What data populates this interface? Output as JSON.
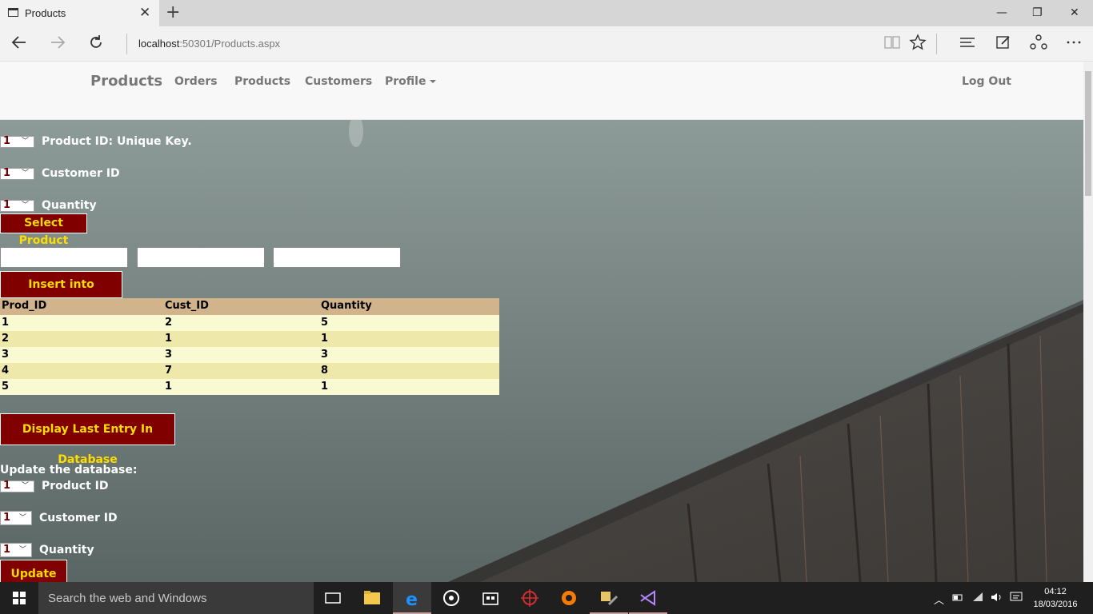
{
  "browser": {
    "tab_title": "Products",
    "tab_close": "✕",
    "new_tab": "+",
    "url_host": "localhost",
    "url_rest": ":50301/Products.aspx",
    "win_min": "—",
    "win_max": "❐",
    "win_close": "✕",
    "icons": [
      "back-icon",
      "forward-icon",
      "refresh-icon",
      "reading-view-icon",
      "favorites-star-icon",
      "hub-icon",
      "web-note-icon",
      "share-icon",
      "more-icon"
    ]
  },
  "navbar": {
    "brand": "Products",
    "links": [
      "Orders",
      "Products",
      "Customers",
      "Profile"
    ],
    "logout": "Log Out"
  },
  "select_form": {
    "product_id_value": "1",
    "product_id_label": "Product ID: Unique Key.",
    "customer_id_value": "1",
    "customer_id_label": "Customer ID",
    "quantity_value": "1",
    "quantity_label": "Quantity",
    "select_button": "Select Product"
  },
  "insert_form": {
    "insert_button": "Insert into Database"
  },
  "products_table": {
    "headers": [
      "Prod_ID",
      "Cust_ID",
      "Quantity"
    ],
    "rows": [
      [
        "1",
        "2",
        "5"
      ],
      [
        "2",
        "1",
        "1"
      ],
      [
        "3",
        "3",
        "3"
      ],
      [
        "4",
        "7",
        "8"
      ],
      [
        "5",
        "1",
        "1"
      ]
    ]
  },
  "display_last_button": "Display Last Entry In Database",
  "update_form": {
    "heading": "Update the database:",
    "product_id_value": "1",
    "product_id_label": "Product ID",
    "customer_id_value": "1",
    "customer_id_label": "Customer ID",
    "quantity_value": "1",
    "quantity_label": "Quantity",
    "update_button": "Update"
  },
  "taskbar": {
    "search_placeholder": "Search the web and Windows",
    "time": "04:12",
    "date": "18/03/2016"
  },
  "colors": {
    "button_bg": "#800000",
    "button_text": "#ffdd00",
    "table_header": "#d2b48c",
    "table_row_odd": "#fafad2",
    "table_row_even": "#eee8aa"
  }
}
